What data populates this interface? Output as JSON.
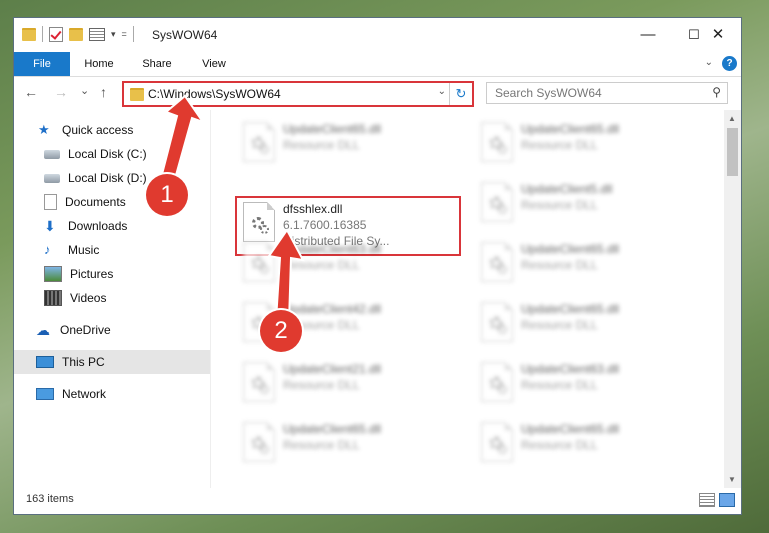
{
  "window": {
    "title": "SysWOW64",
    "min": "—",
    "max": "☐",
    "close": "✕"
  },
  "ribbon": {
    "tabs": [
      "File",
      "Home",
      "Share",
      "View"
    ],
    "help": "?"
  },
  "qat": {
    "dropdown": "▾",
    "more": "="
  },
  "nav": {
    "back": "←",
    "forward": "→",
    "recent": "⌄",
    "up": "↑"
  },
  "address": {
    "path": "C:\\Windows\\SysWOW64",
    "dropdown": "⌄",
    "refresh": "↻"
  },
  "search": {
    "placeholder": "Search SysWOW64",
    "icon": "search-icon"
  },
  "sidebar": {
    "items": [
      {
        "label": "Quick access",
        "icon": "star-icon"
      },
      {
        "label": "Local Disk (C:)",
        "icon": "disk-icon",
        "pinned": true
      },
      {
        "label": "Local Disk (D:)",
        "icon": "disk-icon",
        "pinned": true
      },
      {
        "label": "Documents",
        "icon": "documents-icon",
        "pinned": true
      },
      {
        "label": "Downloads",
        "icon": "download-icon",
        "pinned": true
      },
      {
        "label": "Music",
        "icon": "music-icon",
        "pinned": true
      },
      {
        "label": "Pictures",
        "icon": "pictures-icon",
        "pinned": true
      },
      {
        "label": "Videos",
        "icon": "videos-icon",
        "pinned": true
      },
      {
        "label": "OneDrive",
        "icon": "cloud-icon"
      },
      {
        "label": "This PC",
        "icon": "computer-icon",
        "selected": true
      },
      {
        "label": "Network",
        "icon": "network-icon"
      }
    ],
    "pin_glyph": "📌"
  },
  "files": {
    "featured": {
      "name": "dfsshlex.dll",
      "version": "6.1.7600.16385",
      "description": "Distributed File Sy..."
    },
    "blurred": [
      {
        "name": "UpdateClient65.dll",
        "type": "Resource DLL"
      },
      {
        "name": "UpdateClient65.dll",
        "type": "Resource DLL"
      },
      {
        "name": "UpdateClient5.dll",
        "type": "Resource DLL"
      },
      {
        "name": "UpdateClient63.dll",
        "type": "Resource DLL"
      },
      {
        "name": "UpdateClient65.dll",
        "type": "Resource DLL"
      },
      {
        "name": "UpdateClient42.dll",
        "type": "Resource DLL"
      },
      {
        "name": "UpdateClient65.dll",
        "type": "Resource DLL"
      },
      {
        "name": "UpdateClient21.dll",
        "type": "Resource DLL"
      },
      {
        "name": "UpdateClient63.dll",
        "type": "Resource DLL"
      },
      {
        "name": "UpdateClient65.dll",
        "type": "Resource DLL"
      },
      {
        "name": "UpdateClient65.dll",
        "type": "Resource DLL"
      }
    ]
  },
  "status": {
    "count": "163 items"
  },
  "annotations": {
    "step1": "1",
    "step2": "2",
    "color": "#e03a2f"
  },
  "scroll": {
    "up": "▲",
    "down": "▼"
  }
}
